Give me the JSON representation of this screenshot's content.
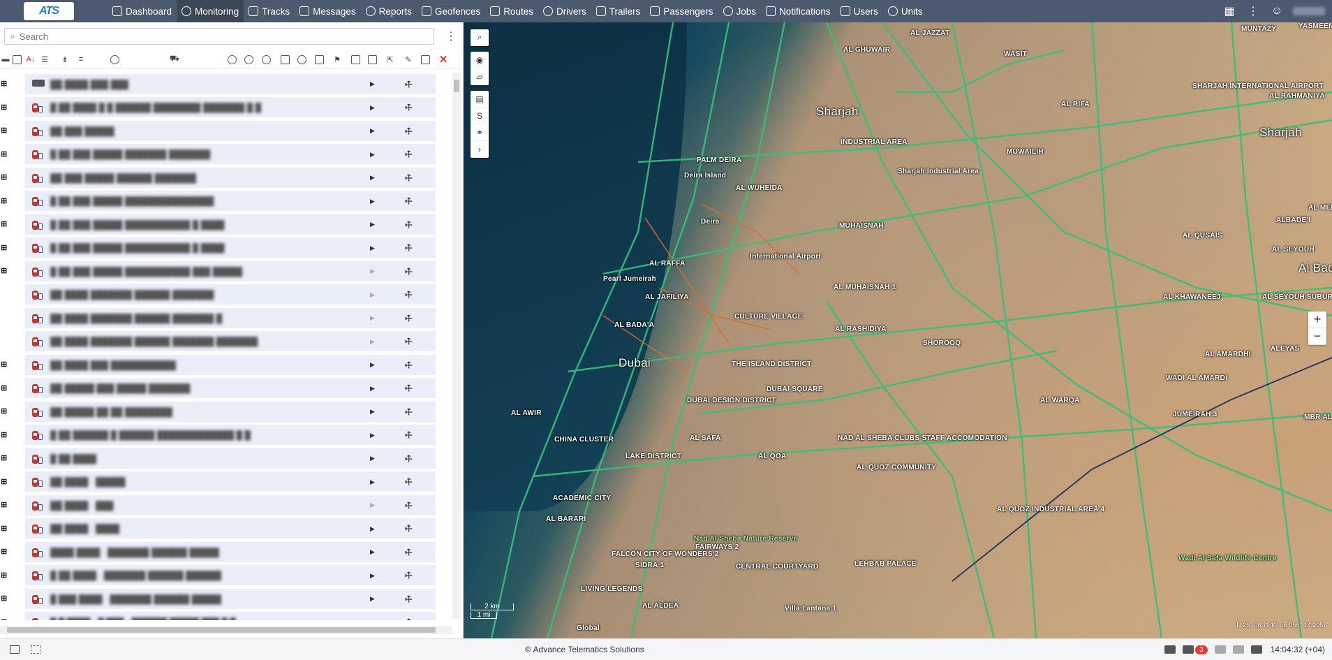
{
  "app": {
    "logo_text": "ATS"
  },
  "nav": [
    {
      "label": "Dashboard",
      "icon": "dashboard-icon"
    },
    {
      "label": "Monitoring",
      "icon": "globe-icon",
      "active": true
    },
    {
      "label": "Tracks",
      "icon": "flag-icon"
    },
    {
      "label": "Messages",
      "icon": "messages-icon"
    },
    {
      "label": "Reports",
      "icon": "reports-icon"
    },
    {
      "label": "Geofences",
      "icon": "geofence-icon"
    },
    {
      "label": "Routes",
      "icon": "routes-icon"
    },
    {
      "label": "Drivers",
      "icon": "steering-wheel-icon"
    },
    {
      "label": "Trailers",
      "icon": "trailer-icon"
    },
    {
      "label": "Passengers",
      "icon": "passenger-icon"
    },
    {
      "label": "Jobs",
      "icon": "jobs-icon"
    },
    {
      "label": "Notifications",
      "icon": "notification-icon"
    },
    {
      "label": "Users",
      "icon": "user-icon"
    },
    {
      "label": "Units",
      "icon": "bus-icon"
    }
  ],
  "search": {
    "placeholder": "Search"
  },
  "units": [
    {
      "name": "██ ████ ███ ███",
      "type": "truck",
      "play_dim": false
    },
    {
      "name": "█ ██ ████ █ █ ██████ ████████ ███████ █ █",
      "type": "car",
      "play_dim": false
    },
    {
      "name": "██ ███ █████",
      "type": "car",
      "play_dim": false
    },
    {
      "name": "█ ██ ███ █████ ███████ ███████",
      "type": "car",
      "play_dim": false
    },
    {
      "name": "██ ███ █████ ██████ ███████",
      "type": "car",
      "play_dim": false
    },
    {
      "name": "█ ██ ███ █████ ███████████████",
      "type": "car",
      "play_dim": false
    },
    {
      "name": "█ ██ ███ █████ ███████████ █ ████",
      "type": "car",
      "play_dim": false
    },
    {
      "name": "█ ██ ███ █████ ███████████ █ ████",
      "type": "car",
      "play_dim": false
    },
    {
      "name": "█ ██ ███ █████ ███████████ ███ █████",
      "type": "car",
      "play_dim": true
    },
    {
      "name": "██ ████ ███████ ██████ ███████",
      "type": "car",
      "play_dim": true
    },
    {
      "name": "██ ████ ███████ ██████ ███████ █",
      "type": "car",
      "play_dim": true
    },
    {
      "name": "██ ████ ███████ ██████ ███████ ███████",
      "type": "car",
      "play_dim": true
    },
    {
      "name": "██ ████ ███ ███████████",
      "type": "car",
      "play_dim": false
    },
    {
      "name": "██ █████ ███ █████ ███████",
      "type": "car",
      "play_dim": false
    },
    {
      "name": "██ █████ ██ ██ ████████",
      "type": "car",
      "play_dim": false
    },
    {
      "name": "█ ██ ██████ █ ██████ █████████████ █ █",
      "type": "car",
      "play_dim": false
    },
    {
      "name": "█ ██ ████",
      "type": "car",
      "play_dim": false
    },
    {
      "name": "██ ████ · █████",
      "type": "car",
      "play_dim": false
    },
    {
      "name": "██ ████ · ███",
      "type": "car",
      "play_dim": true
    },
    {
      "name": "██ ████ · ████",
      "type": "car",
      "play_dim": false
    },
    {
      "name": "████ ████ · ███████ ██████ █████",
      "type": "car",
      "play_dim": false
    },
    {
      "name": "█ ██ ████ · ███████ ██████ ██████",
      "type": "car",
      "play_dim": false
    },
    {
      "name": "█ ███ ████ · ███████ ██████ █████",
      "type": "car",
      "play_dim": false
    },
    {
      "name": "█ █ ████ · █ ███ · ██████ █████ ███ █ █",
      "type": "car",
      "play_dim": false
    }
  ],
  "map": {
    "labels": [
      {
        "text": "Sharjah",
        "big": true
      },
      {
        "text": "Sharjah",
        "big": true
      },
      {
        "text": "Dubai",
        "big": true
      },
      {
        "text": "Al Badaa",
        "big": true
      },
      {
        "text": "AL JAZZAT",
        "big": false
      },
      {
        "text": "MUNTAZY",
        "big": false
      },
      {
        "text": "YASMEEN",
        "big": false
      },
      {
        "text": "AL GHUWAIR",
        "big": false
      },
      {
        "text": "WASIT",
        "big": false
      },
      {
        "text": "SHARJAH INTERNATIONAL AIRPORT",
        "big": false
      },
      {
        "text": "AL RAHMANIYA",
        "big": false
      },
      {
        "text": "AL RIFA",
        "big": false
      },
      {
        "text": "INDUSTRIAL AREA",
        "big": false
      },
      {
        "text": "MUWAILIH",
        "big": false
      },
      {
        "text": "PALM DEIRA",
        "big": false
      },
      {
        "text": "Deira Island",
        "big": false
      },
      {
        "text": "AL WUHEIDA",
        "big": false
      },
      {
        "text": "Sharjah Industrial Area",
        "big": false
      },
      {
        "text": "AL MENHAZ",
        "big": false
      },
      {
        "text": "ALBADE'I",
        "big": false
      },
      {
        "text": "MUHAISNAH",
        "big": false
      },
      {
        "text": "Deira",
        "big": false
      },
      {
        "text": "AL QUSAIS",
        "big": false
      },
      {
        "text": "AL SEYOUH",
        "big": false
      },
      {
        "text": "International Airport",
        "big": false
      },
      {
        "text": "Pearl Jumeirah",
        "big": false
      },
      {
        "text": "AL RAFFA",
        "big": false
      },
      {
        "text": "AL MUHAISNAH 1",
        "big": false
      },
      {
        "text": "AL KHAWANEEJ",
        "big": false
      },
      {
        "text": "AL SEYOUH SUBURB",
        "big": false
      },
      {
        "text": "AL JAFILIYA",
        "big": false
      },
      {
        "text": "AL BADA'A",
        "big": false
      },
      {
        "text": "CULTURE VILLAGE",
        "big": false
      },
      {
        "text": "AL RASHIDIYA",
        "big": false
      },
      {
        "text": "SHOROOQ",
        "big": false
      },
      {
        "text": "AL AMARDHI",
        "big": false
      },
      {
        "text": "ALEYAS",
        "big": false
      },
      {
        "text": "THE ISLAND DISTRICT",
        "big": false
      },
      {
        "text": "WADI AL AMARDI",
        "big": false
      },
      {
        "text": "DUBAI SQUARE",
        "big": false
      },
      {
        "text": "AL WARQA",
        "big": false
      },
      {
        "text": "DUBAI DESIGN DISTRICT",
        "big": false
      },
      {
        "text": "JUMEIRAH 3",
        "big": false
      },
      {
        "text": "AL AWIR",
        "big": false
      },
      {
        "text": "MBR AL MERKAD",
        "big": false
      },
      {
        "text": "AL SAFA",
        "big": false
      },
      {
        "text": "CHINA CLUSTER",
        "big": false
      },
      {
        "text": "NAD AL SHEBA CLUBS STAFF ACCOMODATION",
        "big": false
      },
      {
        "text": "AL QOA",
        "big": false
      },
      {
        "text": "LAKE DISTRICT",
        "big": false
      },
      {
        "text": "AL QUOZ COMMUNITY",
        "big": false
      },
      {
        "text": "ACADEMIC CITY",
        "big": false
      },
      {
        "text": "AL QUOZ INDUSTRIAL AREA 4",
        "big": false
      },
      {
        "text": "AL BARARI",
        "big": false
      },
      {
        "text": "Nad Al Sheba Nature Reserve",
        "big": false
      },
      {
        "text": "FAIRWAYS 2",
        "big": false
      },
      {
        "text": "FALCON CITY OF WONDERS 2",
        "big": false
      },
      {
        "text": "CENTRAL COURTYARD",
        "big": false
      },
      {
        "text": "LEHBAB PALACE",
        "big": false
      },
      {
        "text": "Wadi Al Safa Wildlife Centre",
        "big": false
      },
      {
        "text": "SIDRA 1",
        "big": false
      },
      {
        "text": "LIVING LEGENDS",
        "big": false
      },
      {
        "text": "AL ALDEA",
        "big": false
      },
      {
        "text": "Villa Lantana 1",
        "big": false
      },
      {
        "text": "Global",
        "big": false
      }
    ],
    "scale_km": "2 km",
    "scale_mi": "1 mi",
    "coords": "N 25° 06.7940' : E 055° 14.2057'"
  },
  "footer": {
    "copyright": "© Advance Telematics Solutions",
    "badge_count": "3",
    "time": "14:04:32 (+04)"
  }
}
